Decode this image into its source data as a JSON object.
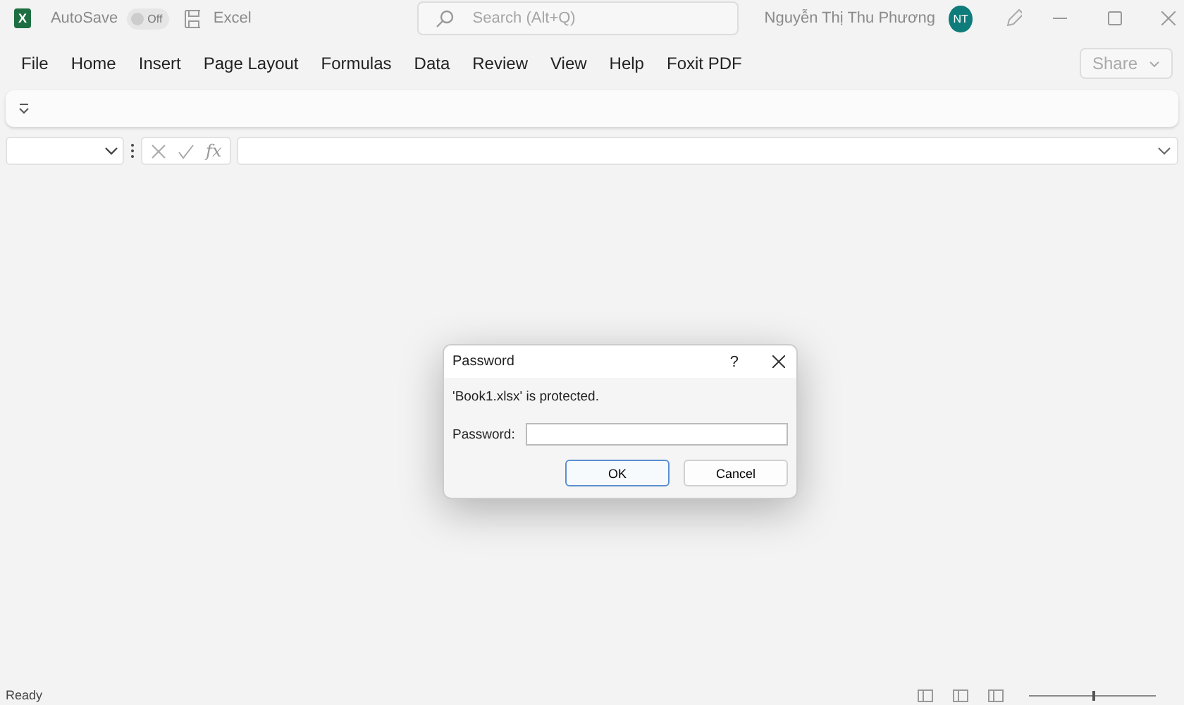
{
  "title_bar": {
    "logo_text": "X",
    "autosave": {
      "label": "AutoSave",
      "on": false,
      "state_text": "Off"
    },
    "app_name": "Excel",
    "search": {
      "placeholder": "Search (Alt+Q)"
    },
    "user_name": "Nguyễn Thị Thu Phương",
    "avatar_initials": "NT"
  },
  "menu": {
    "items": [
      "File",
      "Home",
      "Insert",
      "Page Layout",
      "Formulas",
      "Data",
      "Review",
      "View",
      "Help",
      "Foxit PDF"
    ],
    "share": "Share"
  },
  "formula_bar": {
    "fx": "fx"
  },
  "dialog": {
    "title": "Password",
    "help": "?",
    "message": "'Book1.xlsx' is protected.",
    "field_label": "Password:",
    "buttons": [
      {
        "label": "OK",
        "default": true
      },
      {
        "label": "Cancel",
        "default": false
      }
    ]
  },
  "status_bar": {
    "text": "Ready",
    "level": 0.5
  }
}
